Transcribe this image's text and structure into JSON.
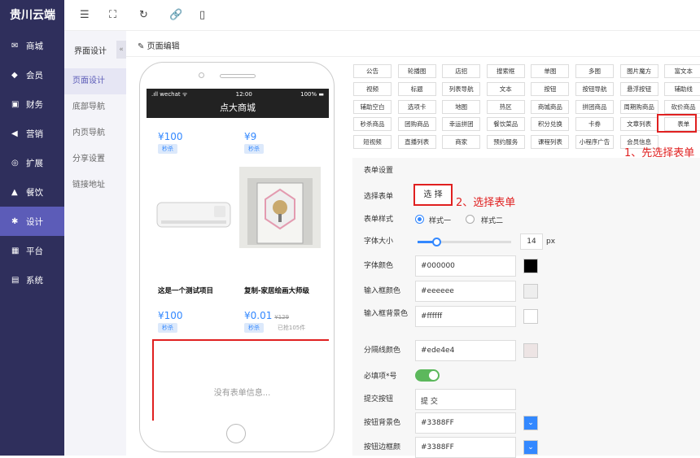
{
  "app": {
    "brand": "贵川云端"
  },
  "sidebar": {
    "items": [
      {
        "label": "商城",
        "icon": "✉"
      },
      {
        "label": "会员",
        "icon": "◆"
      },
      {
        "label": "财务",
        "icon": "▣"
      },
      {
        "label": "营销",
        "icon": "◀"
      },
      {
        "label": "扩展",
        "icon": "◎"
      },
      {
        "label": "餐饮",
        "icon": "▲"
      },
      {
        "label": "设计",
        "icon": "✱",
        "active": true
      },
      {
        "label": "平台",
        "icon": "▦"
      },
      {
        "label": "系统",
        "icon": "▤"
      }
    ]
  },
  "subnav": {
    "title": "界面设计",
    "collapse": "«",
    "items": [
      {
        "label": "页面设计",
        "active": true
      },
      {
        "label": "底部导航"
      },
      {
        "label": "内页导航"
      },
      {
        "label": "分享设置"
      },
      {
        "label": "链接地址"
      }
    ]
  },
  "editor": {
    "title": "页面编辑"
  },
  "preview": {
    "status_left": ".ıll wechat ᯤ",
    "status_time": "12:00",
    "status_right": "100% ▬",
    "app_title": "点大商城",
    "product1_price": "¥100",
    "product1_tag": "秒杀",
    "product2_price": "¥9",
    "product2_tag": "秒杀",
    "product3_name": "这是一个测试项目",
    "product3_price": "¥100",
    "product3_tag": "秒杀",
    "product4_name": "复制-家居绘画大师级",
    "product4_price": "¥0.01",
    "product4_old": "¥129",
    "product4_tag": "秒杀",
    "product4_sold": "已抢105件",
    "empty_form": "没有表单信息..."
  },
  "components": [
    "公告",
    "轮播图",
    "店招",
    "搜索框",
    "单图",
    "多图",
    "图片魔方",
    "富文本",
    "视频",
    "标题",
    "列表导航",
    "文本",
    "按钮",
    "按钮导航",
    "悬浮按钮",
    "辅助线",
    "辅助空白",
    "选项卡",
    "地图",
    "热区",
    "商城商品",
    "拼团商品",
    "周期购商品",
    "砍价商品",
    "秒杀商品",
    "团购商品",
    "幸运拼团",
    "餐饮菜品",
    "积分兑换",
    "卡券",
    "文章列表",
    "表单",
    "短视频",
    "直播列表",
    "商家",
    "预约服务",
    "课程列表",
    "小程序广告",
    "会员信息"
  ],
  "annotations": {
    "step1": "1、先选择表单控件",
    "step2": "2、选择表单"
  },
  "form_settings": {
    "title": "表单设置",
    "select_form_label": "选择表单",
    "select_button": "选 择",
    "style_label": "表单样式",
    "style_option1": "样式一",
    "style_option2": "样式二",
    "style_selected": 1,
    "font_size_label": "字体大小",
    "font_size": 14,
    "font_size_unit": "px",
    "font_size_slider": 0.2,
    "font_color_label": "字体颜色",
    "font_color": "#000000",
    "input_border_label": "输入框颜色",
    "input_border_color": "#eeeeee",
    "input_bg_label": "输入框背景色",
    "input_bg_color": "#ffffff",
    "divider_label": "分隔线颜色",
    "divider_color": "#ede4e4",
    "required_label": "必填项*号",
    "required_on": true,
    "submit_label": "提交按钮",
    "submit_text": "提 交",
    "btn_bg_label": "按钮背景色",
    "btn_bg_color": "#3388FF",
    "btn_border_label": "按钮边框颜",
    "btn_border_color": "#3388FF"
  }
}
